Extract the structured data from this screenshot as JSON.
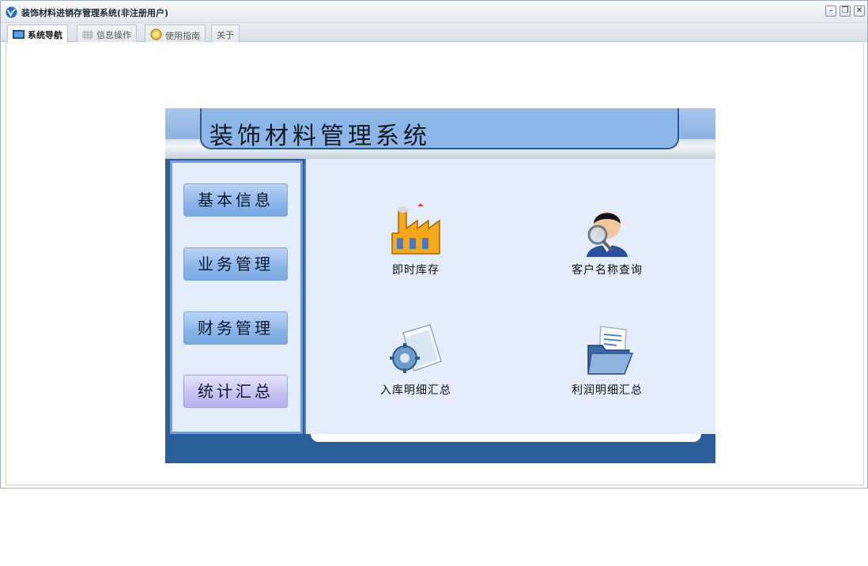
{
  "window": {
    "title": "装饰材料进销存管理系统(非注册用户)",
    "controls": [
      "minimize",
      "restore",
      "close"
    ]
  },
  "tabs": [
    {
      "label": "系统导航",
      "icon": "monitor-icon",
      "active": true
    },
    {
      "label": "信息操作",
      "icon": "grid-icon",
      "active": false
    },
    {
      "label": "使用指南",
      "icon": "help-circle-icon",
      "active": false
    },
    {
      "label": "关于",
      "icon": "",
      "active": false
    }
  ],
  "panel": {
    "title": "装饰材料管理系统",
    "sidebar": [
      {
        "label": "基本信息"
      },
      {
        "label": "业务管理"
      },
      {
        "label": "财务管理"
      },
      {
        "label": "统计汇总"
      }
    ],
    "tiles": [
      {
        "label": "即时库存",
        "icon": "factory-icon"
      },
      {
        "label": "客户名称查询",
        "icon": "user-search-icon"
      },
      {
        "label": "入库明细汇总",
        "icon": "document-gear-icon"
      },
      {
        "label": "利润明细汇总",
        "icon": "folder-document-icon"
      }
    ]
  },
  "colors": {
    "panel_border": "#2b5f9c",
    "banner": "#8cb6e6",
    "content_bg": "#e3edfb",
    "sidebar_button": "#8db7ea",
    "sidebar_button_alt": "#c8c2f3"
  }
}
